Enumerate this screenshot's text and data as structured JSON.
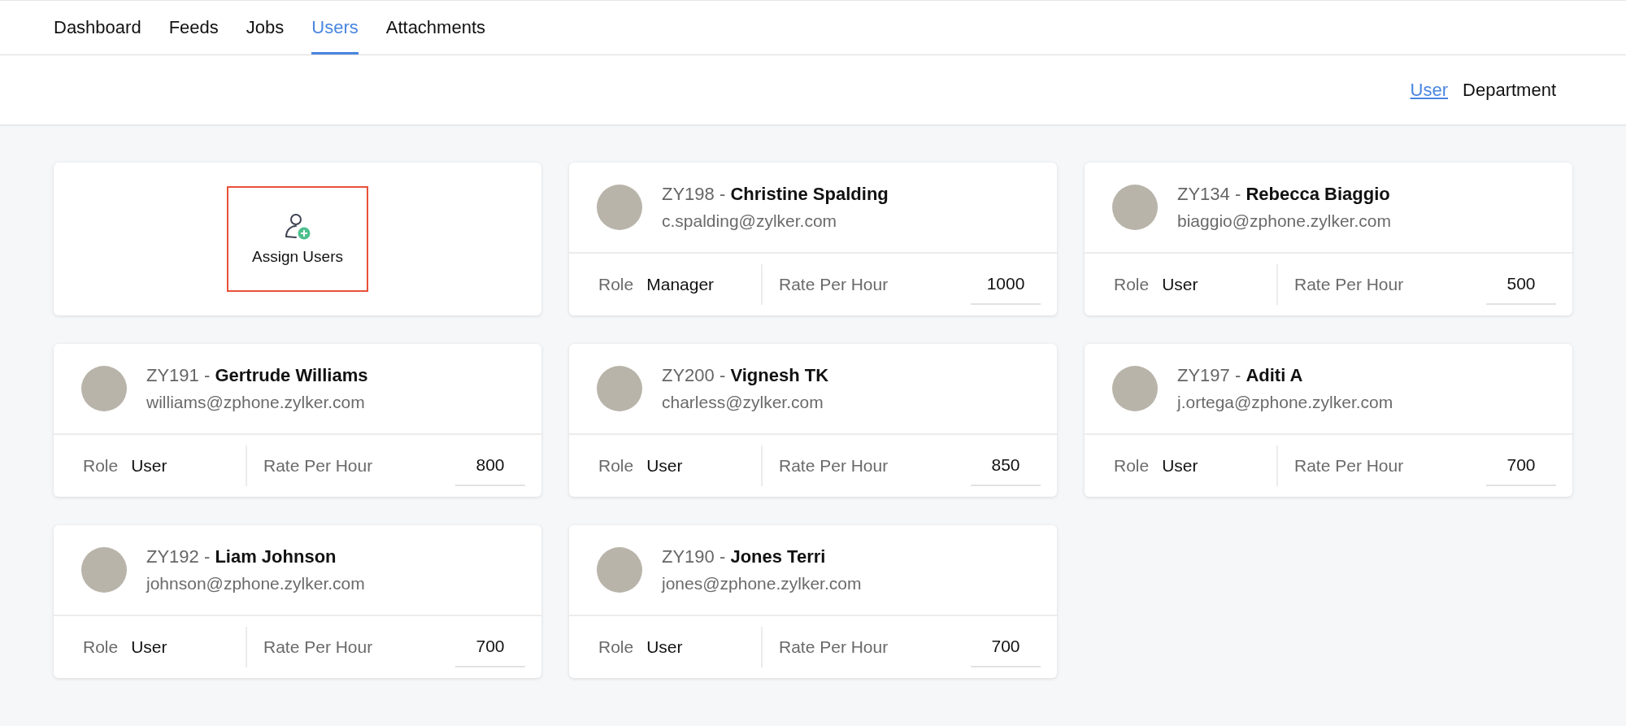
{
  "tabs": [
    {
      "label": "Dashboard",
      "selected": false
    },
    {
      "label": "Feeds",
      "selected": false
    },
    {
      "label": "Jobs",
      "selected": false
    },
    {
      "label": "Users",
      "selected": true
    },
    {
      "label": "Attachments",
      "selected": false
    }
  ],
  "view_switch": [
    {
      "label": "User",
      "selected": true
    },
    {
      "label": "Department",
      "selected": false
    }
  ],
  "assign_card": {
    "label": "Assign Users"
  },
  "users": [
    {
      "id": "ZY198",
      "separator": "-",
      "name": "Christine Spalding",
      "email": "c.spalding@zylker.com",
      "role_label": "Role",
      "role": "Manager",
      "rate_label": "Rate Per Hour",
      "rate": "1000"
    },
    {
      "id": "ZY134",
      "separator": "-",
      "name": "Rebecca Biaggio",
      "email": "biaggio@zphone.zylker.com",
      "role_label": "Role",
      "role": "User",
      "rate_label": "Rate Per Hour",
      "rate": "500"
    },
    {
      "id": "ZY191",
      "separator": "-",
      "name": "Gertrude Williams",
      "email": "williams@zphone.zylker.com",
      "role_label": "Role",
      "role": "User",
      "rate_label": "Rate Per Hour",
      "rate": "800"
    },
    {
      "id": "ZY200",
      "separator": "-",
      "name": "Vignesh TK",
      "email": "charless@zylker.com",
      "role_label": "Role",
      "role": "User",
      "rate_label": "Rate Per Hour",
      "rate": "850"
    },
    {
      "id": "ZY197",
      "separator": "-",
      "name": "Aditi A",
      "email": "j.ortega@zphone.zylker.com",
      "role_label": "Role",
      "role": "User",
      "rate_label": "Rate Per Hour",
      "rate": "700"
    },
    {
      "id": "ZY192",
      "separator": "-",
      "name": "Liam Johnson",
      "email": "johnson@zphone.zylker.com",
      "role_label": "Role",
      "role": "User",
      "rate_label": "Rate Per Hour",
      "rate": "700"
    },
    {
      "id": "ZY190",
      "separator": "-",
      "name": "Jones Terri",
      "email": "jones@zphone.zylker.com",
      "role_label": "Role",
      "role": "User",
      "rate_label": "Rate Per Hour",
      "rate": "700"
    }
  ]
}
